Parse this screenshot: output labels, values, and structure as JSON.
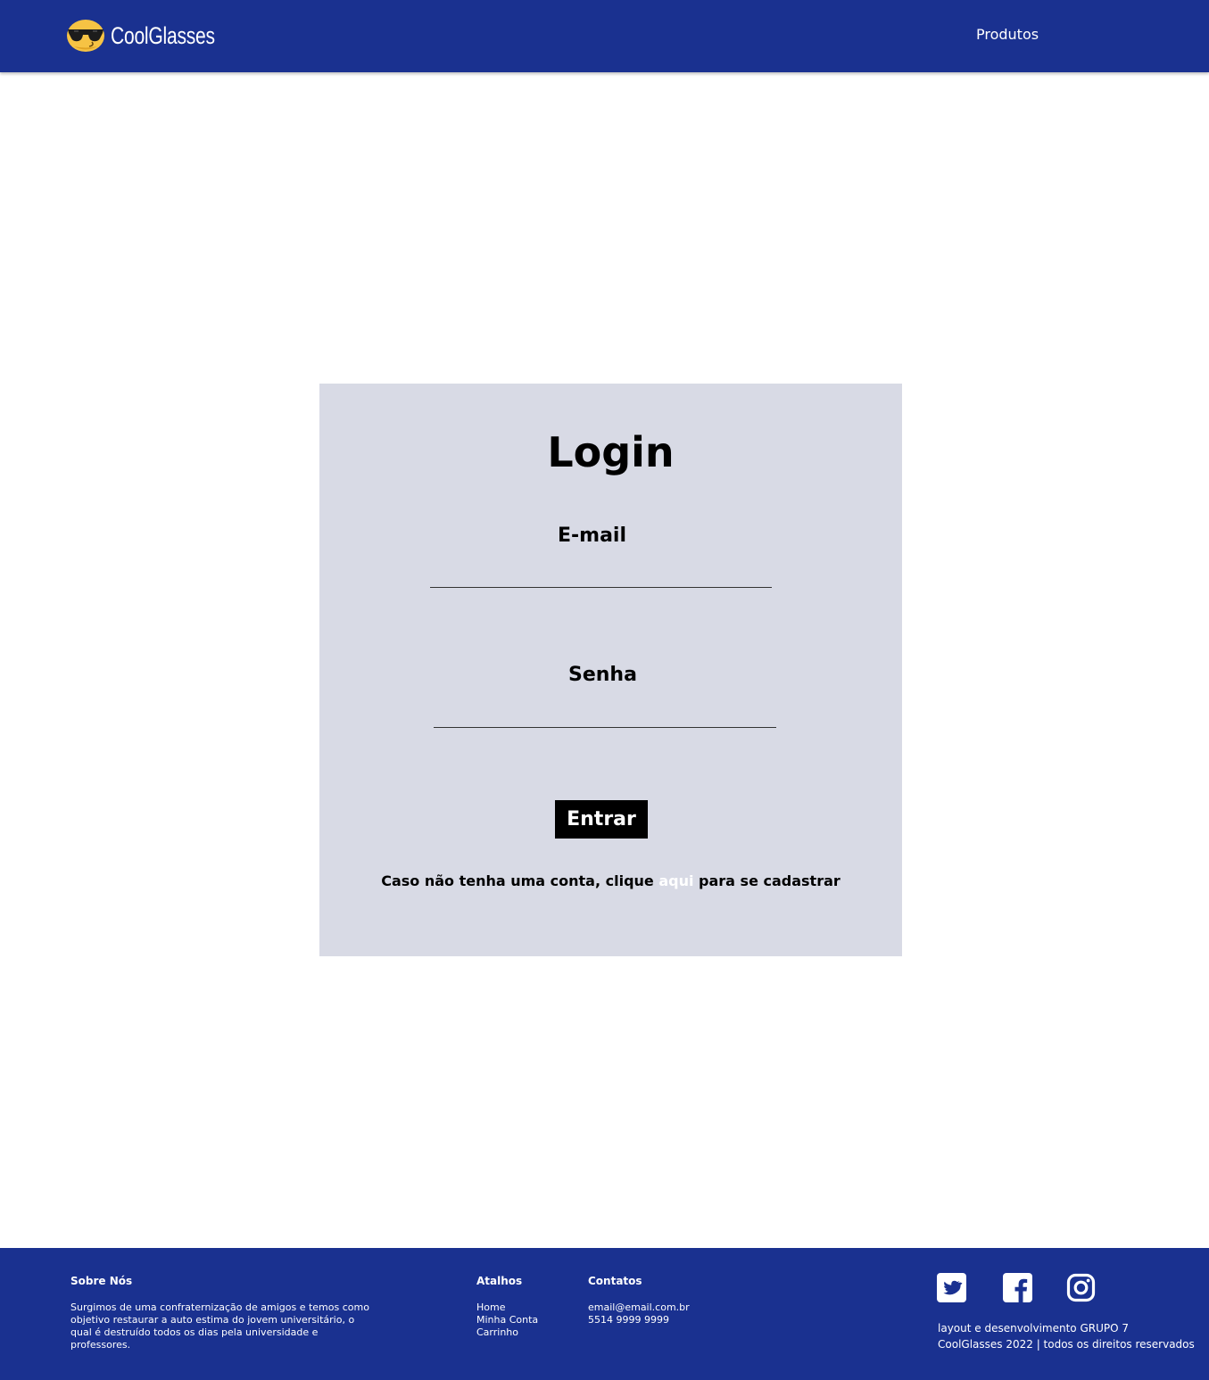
{
  "header": {
    "brand_name": "CoolGlasses",
    "brand_icon": "sunglasses-emoji-icon",
    "nav": {
      "produtos": "Produtos"
    },
    "color": "#1a3190"
  },
  "login": {
    "title": "Login",
    "email_label": "E-mail",
    "email_value": "",
    "senha_label": "Senha",
    "senha_value": "",
    "submit_label": "Entrar",
    "signup_prefix": "Caso não tenha uma conta, clique ",
    "signup_link": "aqui",
    "signup_suffix": " para se cadastrar",
    "card_color": "#d8dae5"
  },
  "footer": {
    "sobre": {
      "heading": "Sobre Nós",
      "text": "Surgimos de uma confraternização de amigos e temos como objetivo restaurar a auto estima do jovem universitário, o qual é destruído todos os dias pela universidade e professores."
    },
    "atalhos": {
      "heading": "Atalhos",
      "items": [
        "Home",
        "Minha Conta",
        "Carrinho"
      ]
    },
    "contatos": {
      "heading": "Contatos",
      "email": "email@email.com.br",
      "phone": "5514 9999 9999"
    },
    "social_icons": [
      "twitter-icon",
      "facebook-icon",
      "instagram-icon"
    ],
    "credits_line1": "layout e desenvolvimento GRUPO 7",
    "credits_line2": "CoolGlasses 2022 | todos os direitos reservados"
  }
}
